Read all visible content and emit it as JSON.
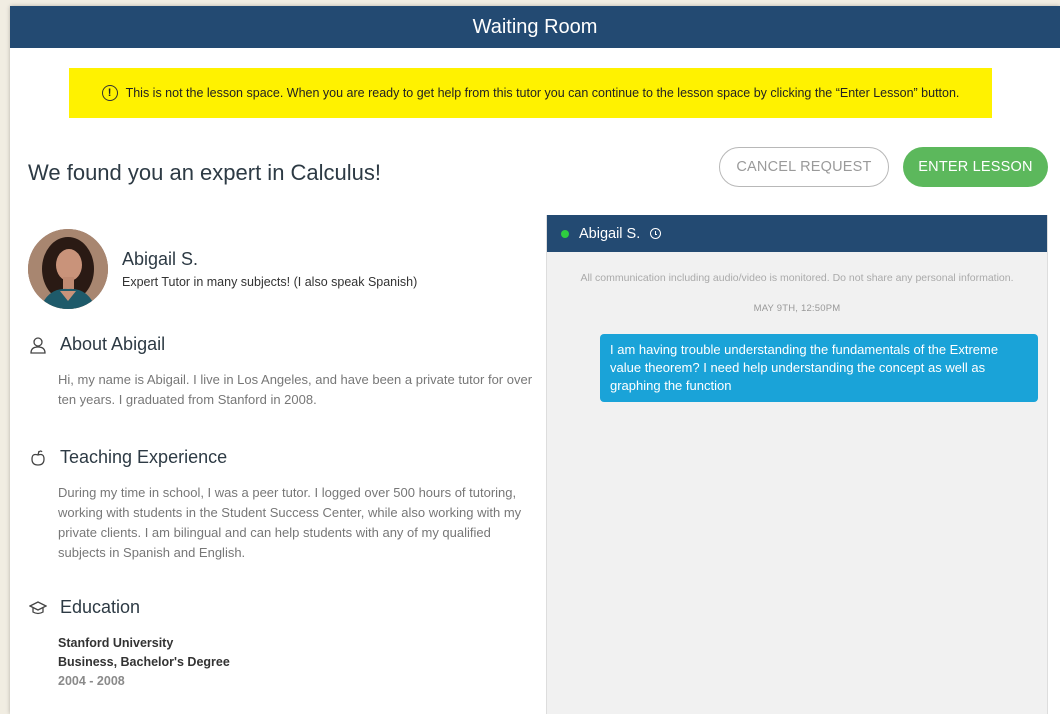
{
  "header": {
    "title": "Waiting Room"
  },
  "notice": {
    "icon": "info-icon",
    "text": "This is not the lesson space. When you are ready to get help from this tutor you can continue to the lesson space by clicking the “Enter Lesson” button."
  },
  "headline": "We found you an expert in Calculus!",
  "actions": {
    "cancel_label": "CANCEL REQUEST",
    "enter_label": "ENTER LESSON",
    "enter_color": "#5cb85c"
  },
  "tutor": {
    "name": "Abigail S.",
    "tagline": "Expert Tutor in many subjects! (I also speak Spanish)"
  },
  "about": {
    "title": "About Abigail",
    "text": "Hi, my name is Abigail. I live in Los Angeles, and have been a private tutor for over ten years. I graduated from Stanford in 2008."
  },
  "teaching": {
    "title": "Teaching Experience",
    "text": "During my time in school, I was a peer tutor. I logged over 500 hours of tutoring, working with students in the Student Success Center, while also working with my private clients. I am bilingual and can help students with any of my qualified subjects in Spanish and English."
  },
  "education": {
    "title": "Education",
    "school": "Stanford University",
    "degree": "Business,  Bachelor's Degree",
    "years": "2004 - 2008"
  },
  "chat": {
    "header_name": "Abigail S.",
    "status": "online",
    "disclaimer": "All communication including audio/video is monitored. Do not share any personal information.",
    "date": "MAY 9TH, 12:50PM",
    "messages": [
      {
        "from": "student",
        "text": "I am having trouble understanding the fundamentals of the Extreme value theorem? I need help understanding the concept as well as graphing the function"
      }
    ]
  },
  "colors": {
    "header_bg": "#234a72",
    "notice_bg": "#fff200",
    "bubble_bg": "#1aa3d8"
  }
}
